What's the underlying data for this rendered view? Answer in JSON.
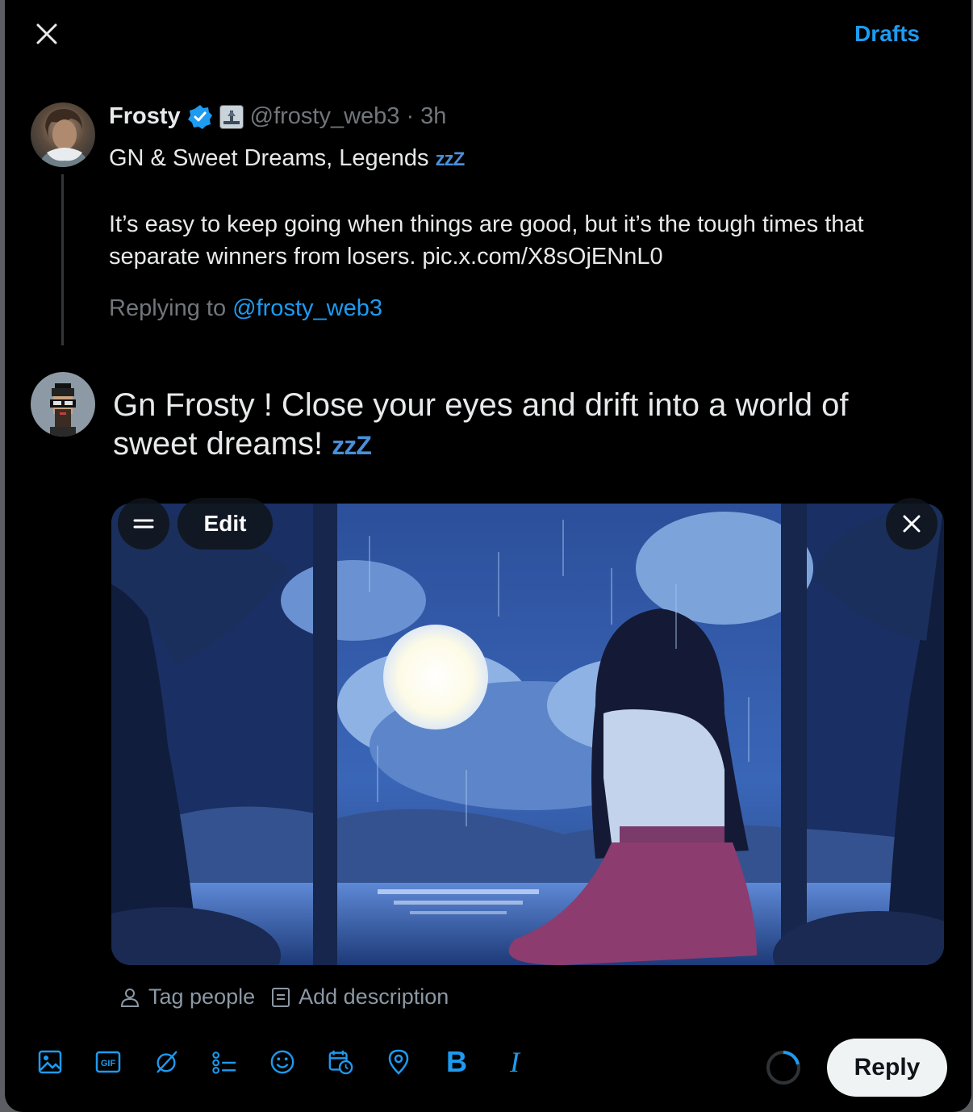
{
  "header": {
    "drafts_label": "Drafts"
  },
  "original_tweet": {
    "name": "Frosty",
    "handle": "@frosty_web3",
    "separator": "·",
    "time": "3h",
    "line1": "GN & Sweet Dreams, Legends",
    "zzz": "zzZ",
    "body": "It’s easy to keep going when things are good, but it’s the tough times that separate winners from losers. pic.x.com/X8sOjENnL0",
    "replying_prefix": "Replying to",
    "replying_mention": "@frosty_web3"
  },
  "compose": {
    "text": "Gn Frosty ! Close your eyes and drift into a world of sweet dreams!",
    "zzz": "zzZ"
  },
  "media": {
    "edit_label": "Edit",
    "tag_people_label": "Tag people",
    "add_description_label": "Add description"
  },
  "toolbar": {
    "icons": [
      "image-icon",
      "gif-icon",
      "grok-icon",
      "poll-icon",
      "emoji-icon",
      "schedule-icon",
      "location-icon",
      "bold-icon",
      "italic-icon"
    ],
    "gif_text": "GIF",
    "bold_text": "B",
    "italic_text": "I"
  },
  "reply_label": "Reply",
  "colors": {
    "accent": "#1d9bf0",
    "background": "#000000",
    "muted": "#71767b"
  }
}
